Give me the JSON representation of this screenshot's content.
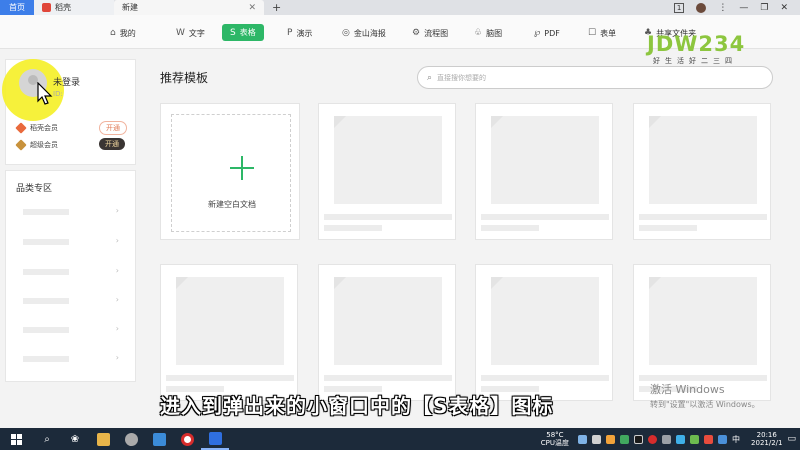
{
  "titlebar": {
    "tabs": [
      {
        "label": "首页"
      },
      {
        "label": "稻壳"
      },
      {
        "label": "新建"
      }
    ],
    "badge": "1"
  },
  "toolbar": {
    "items": [
      {
        "label": "我的",
        "icon": "home-icon"
      },
      {
        "label": "文字",
        "icon": "word-icon"
      },
      {
        "label": "表格",
        "icon": "sheet-icon",
        "active": true
      },
      {
        "label": "演示",
        "icon": "presentation-icon"
      },
      {
        "label": "金山海报",
        "icon": "poster-icon"
      },
      {
        "label": "流程图",
        "icon": "flowchart-icon"
      },
      {
        "label": "脑图",
        "icon": "mindmap-icon"
      },
      {
        "label": "PDF",
        "icon": "pdf-icon"
      },
      {
        "label": "表单",
        "icon": "form-icon"
      },
      {
        "label": "共享文件夹",
        "icon": "shared-folder-icon"
      }
    ],
    "accent": "#2db767"
  },
  "watermark": {
    "big": "JDW234",
    "small": "好生活好二三四"
  },
  "user": {
    "status": "未登录",
    "id_label": "ID:",
    "members": [
      {
        "name": "稻壳会员",
        "button": "开通"
      },
      {
        "name": "超级会员",
        "button": "开通"
      }
    ]
  },
  "categories": {
    "title": "品类专区"
  },
  "main": {
    "title": "推荐模板",
    "search_placeholder": "直接搜你想要的",
    "new_doc_label": "新建空白文档"
  },
  "subtitle": "进入到弹出来的小窗口中的【S表格】图标",
  "activation": {
    "line1": "激活 Windows",
    "line2": "转到\"设置\"以激活 Windows。"
  },
  "taskbar": {
    "weather_temp": "58°C",
    "weather_label": "CPU温度",
    "ime": "中",
    "time": "20:16",
    "date": "2021/2/1"
  }
}
